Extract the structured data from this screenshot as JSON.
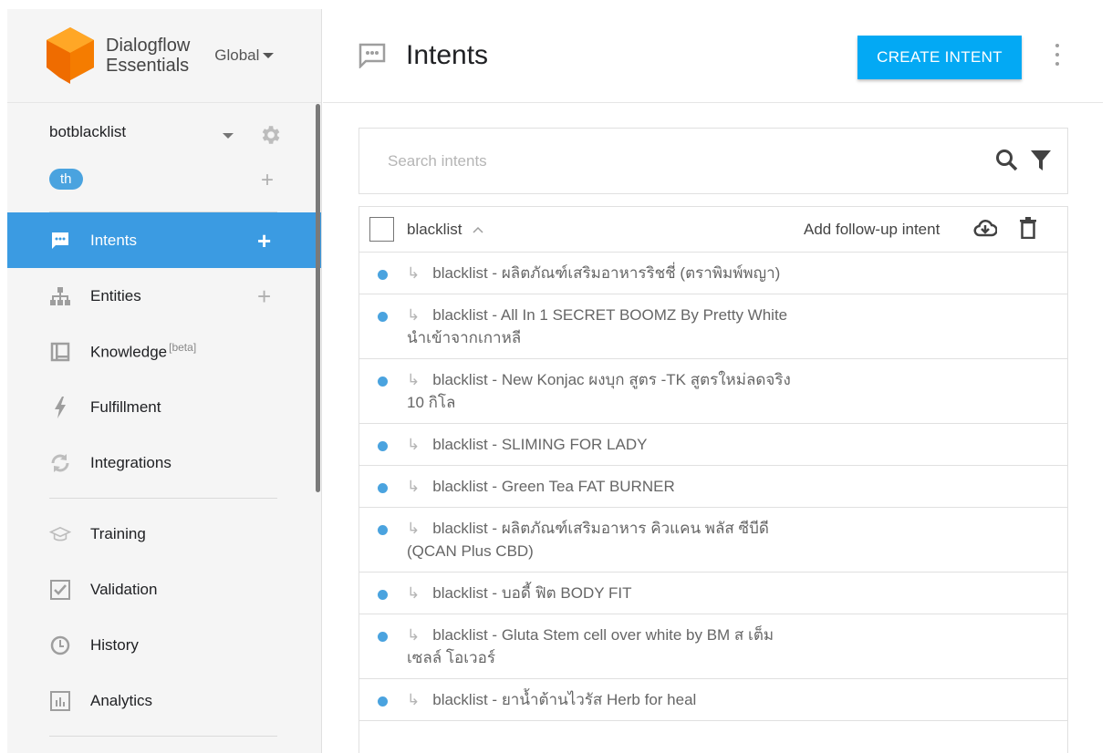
{
  "brand": {
    "name_line1": "Dialogflow",
    "name_line2": "Essentials",
    "region": "Global"
  },
  "agent": {
    "name": "botblacklist",
    "language": "th"
  },
  "nav": {
    "items": [
      {
        "label": "Intents",
        "beta": ""
      },
      {
        "label": "Entities",
        "beta": ""
      },
      {
        "label": "Knowledge",
        "beta": "[beta]"
      },
      {
        "label": "Fulfillment",
        "beta": ""
      },
      {
        "label": "Integrations",
        "beta": ""
      },
      {
        "label": "Training",
        "beta": ""
      },
      {
        "label": "Validation",
        "beta": ""
      },
      {
        "label": "History",
        "beta": ""
      },
      {
        "label": "Analytics",
        "beta": ""
      }
    ],
    "active": "Intents"
  },
  "header": {
    "title": "Intents",
    "create_button": "CREATE INTENT"
  },
  "search": {
    "placeholder": "Search intents",
    "value": ""
  },
  "list": {
    "parent_intent": "blacklist",
    "followup_label": "Add follow-up intent",
    "rows": [
      "blacklist - ผลิตภัณฑ์เสริมอาหารริชชี่ (ตราพิมพ์พญา)",
      "blacklist - All In 1 SECRET BOOMZ By Pretty White นำเข้าจากเกาหลี",
      "blacklist - New Konjac ผงบุก สูตร -TK สูตรใหม่ลดจริง 10 กิโล",
      "blacklist - SLIMING FOR LADY",
      "blacklist - Green Tea FAT BURNER",
      "blacklist - ผลิตภัณฑ์เสริมอาหาร คิวแคน พลัส ซีบีดี (QCAN Plus CBD)",
      "blacklist - บอดี้ ฟิต BODY FIT",
      "blacklist - Gluta Stem cell over white by BM ส เต็มเซลล์ โอเวอร์",
      "blacklist - ยาน้ำต้านไวรัส Herb for heal"
    ]
  },
  "colors": {
    "accent": "#3b9be2",
    "button": "#03a9f4",
    "dot": "#4aa3df",
    "logo": "#ff9800"
  }
}
